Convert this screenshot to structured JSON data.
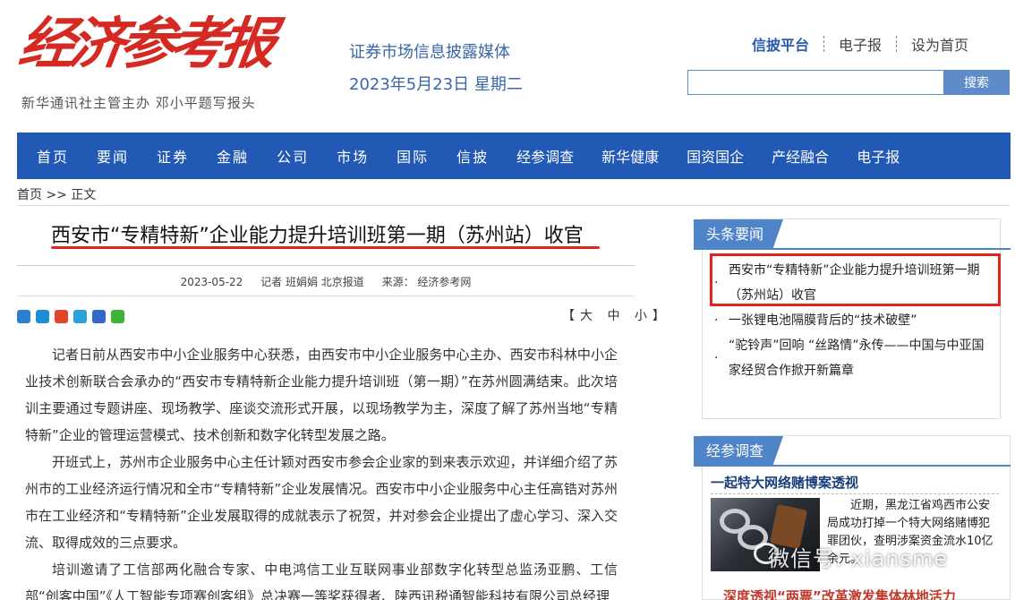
{
  "header": {
    "logo_text": "经济参考报",
    "logo_sub": "新华通讯社主管主办  邓小平题写报头",
    "slogan": "证券市场信息披露媒体",
    "date": "2023年5月23日 星期二",
    "links": [
      "信披平台",
      "电子报",
      "设为首页"
    ],
    "search_placeholder": "",
    "search_button": "搜索"
  },
  "nav": {
    "items": [
      "首页",
      "要闻",
      "证券",
      "金融",
      "公司",
      "市场",
      "国际",
      "信披",
      "经参调查",
      "新华健康",
      "国资国企",
      "产经融合",
      "电子报"
    ]
  },
  "breadcrumb": {
    "home": "首页",
    "sep": ">>",
    "current": "正文"
  },
  "article": {
    "title": "西安市“专精特新”企业能力提升培训班第一期（苏州站）收官",
    "date": "2023-05-22",
    "reporter": "记者 班娟娟 北京报道",
    "source": "来源：  经济参考网",
    "font_size_control": "【大 中 小】",
    "paragraphs": [
      "记者日前从西安市中小企业服务中心获悉，由西安市中小企业服务中心主办、西安市科林中小企业技术创新联合会承办的“西安市专精特新企业能力提升培训班（第一期）”在苏州圆满结束。此次培训主要通过专题讲座、现场教学、座谈交流形式开展，以现场教学为主，深度了解了苏州当地“专精特新”企业的管理运营模式、技术创新和数字化转型发展之路。",
      "开班式上，苏州市企业服务中心主任计颖对西安市参会企业家的到来表示欢迎，并详细介绍了苏州市的工业经济运行情况和全市“专精特新”企业发展情况。西安市中小企业服务中心主任高锆对苏州市在工业经济和“专精特新”企业发展取得的成就表示了祝贺，并对参会企业提出了虚心学习、深入交流、取得成效的三点要求。",
      "培训邀请了工信部两化融合专家、中电鸿信工业互联网事业部数字化转型总监汤亚鹏、工信部“创客中国”《人工智能专项赛创客组》总决赛一等奖获得者、陕西讯税通智能科技有限公司总经理"
    ]
  },
  "sidebar": {
    "headlines_title": "头条要闻",
    "headlines": [
      "西安市“专精特新”企业能力提升培训班第一期（苏州站）收官",
      "一张锂电池隔膜背后的“技术破壁”",
      "“驼铃声”回响 “丝路情”永传——中国与中亚国家经贸合作掀开新篇章"
    ],
    "investigation_title": "经参调查",
    "investigation_headline": "一起特大网络赌博案透视",
    "investigation_text": "近期，黑龙江省鸡西市公安局成功打掉一个特大网络赌博犯罪团伙，查明涉案资金流水10亿余元。",
    "watermark": "微信号: xiansme",
    "bottom_cut": "深度透视“两票”改革激发集体林地活力"
  },
  "colors": {
    "nav_bg": "#2259b5",
    "logo_red": "#d52a23",
    "accent_blue": "#4f84c8",
    "highlight_red": "#e3231c"
  }
}
